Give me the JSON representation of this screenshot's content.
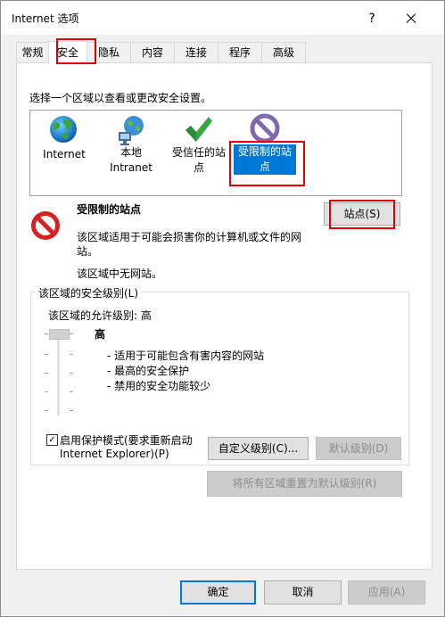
{
  "window": {
    "title": "Internet 选项",
    "help_glyph": "?"
  },
  "tabs": [
    {
      "label": "常规"
    },
    {
      "label": "安全"
    },
    {
      "label": "隐私"
    },
    {
      "label": "内容"
    },
    {
      "label": "连接"
    },
    {
      "label": "程序"
    },
    {
      "label": "高级"
    }
  ],
  "zones_prompt": "选择一个区域以查看或更改安全设置。",
  "zones": [
    {
      "label_line1": "Internet",
      "label_line2": ""
    },
    {
      "label_line1": "本地",
      "label_line2": "Intranet"
    },
    {
      "label_line1": "受信任的站",
      "label_line2": "点"
    },
    {
      "label_line1": "受限制的站",
      "label_line2": "点"
    }
  ],
  "zone_detail": {
    "title": "受限制的站点",
    "desc_line1": "该区域适用于可能会损害你的计算机或文件的网",
    "desc_line2": "站。",
    "no_sites": "该区域中无网站。",
    "sites_button": "站点(S)"
  },
  "security_level": {
    "group_label": "该区域的安全级别(L)",
    "allowed_label": "该区域的允许级别: 高",
    "level_name": "高",
    "bullets": [
      "- 适用于可能包含有害内容的网站",
      "- 最高的安全保护",
      "- 禁用的安全功能较少"
    ],
    "protected_mode_line1": "启用保护模式(要求重新启动",
    "protected_mode_line2": "Internet Explorer)(P)",
    "protected_mode_checked": true,
    "custom_level_button": "自定义级别(C)...",
    "default_level_button": "默认级别(D)",
    "reset_all_button": "将所有区域重置为默认级别(R)"
  },
  "footer": {
    "ok": "确定",
    "cancel": "取消",
    "apply": "应用(A)"
  },
  "colors": {
    "accent": "#0078d7",
    "annotation_red": "#e00000"
  }
}
